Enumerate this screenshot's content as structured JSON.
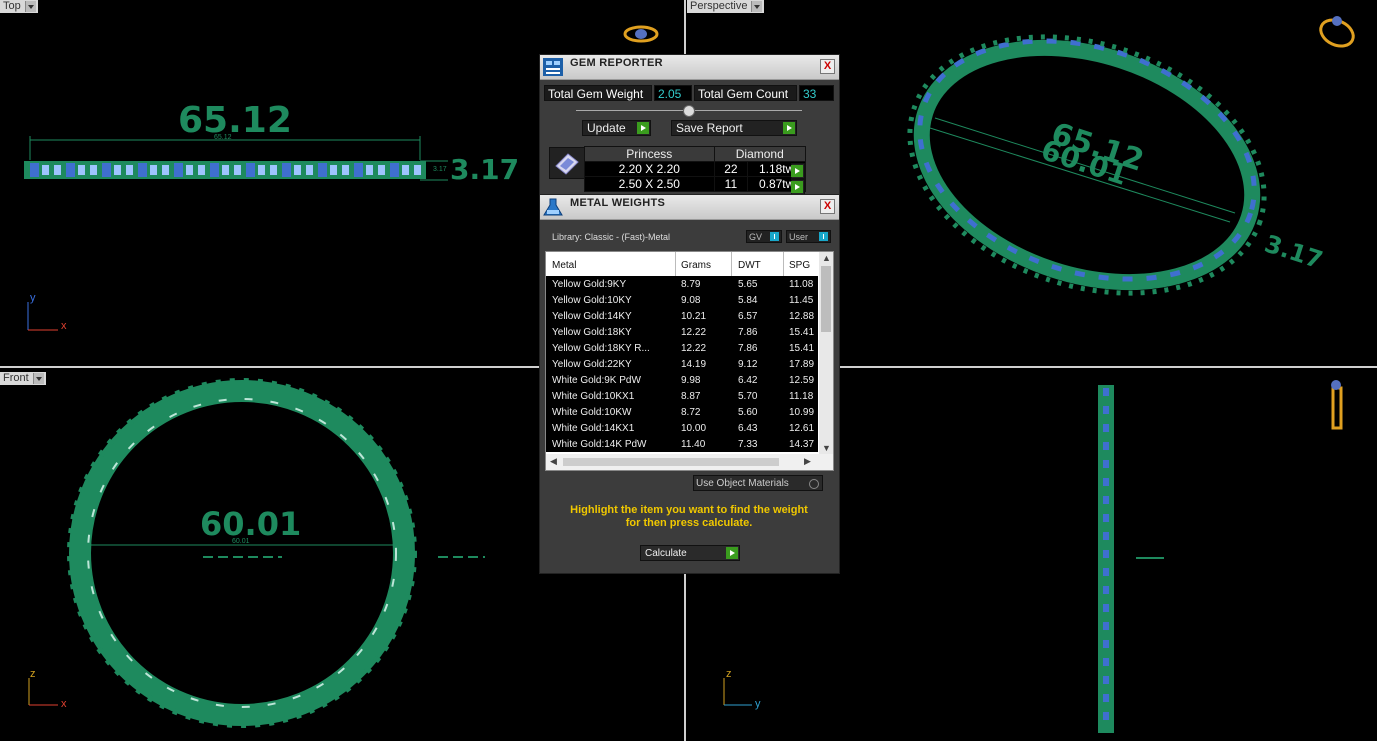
{
  "viewports": {
    "top": {
      "label": "Top",
      "dim_length": "65.12",
      "dim_length_small": "65.12",
      "dim_height": "3.17",
      "dim_height_small": "3.17",
      "axis_y": "y",
      "axis_x": "x"
    },
    "perspective": {
      "label": "Perspective",
      "dim_a": "65.12",
      "dim_b": "60.01",
      "dim_c": "3.17"
    },
    "front": {
      "label": "Front",
      "dim_diameter": "60.01",
      "dim_diameter_small": "60.01",
      "axis_z": "z",
      "axis_x": "x"
    },
    "right": {
      "axis_z": "z",
      "axis_y": "y"
    }
  },
  "gem_reporter": {
    "title": "GEM REPORTER",
    "close_label": "X",
    "total_weight_label": "Total Gem Weight",
    "total_weight_value": "2.05",
    "total_count_label": "Total Gem Count",
    "total_count_value": "33",
    "update_label": "Update",
    "save_report_label": "Save Report",
    "table": {
      "headers": [
        "Princess",
        "Diamond"
      ],
      "rows": [
        {
          "size": "2.20 X 2.20",
          "count": "22",
          "weight": "1.18tw"
        },
        {
          "size": "2.50 X 2.50",
          "count": "11",
          "weight": "0.87tw"
        }
      ]
    }
  },
  "metal_weights": {
    "title": "METAL WEIGHTS",
    "close_label": "X",
    "library_label": "Library: Classic - (Fast)-Metal",
    "gv_label": "GV",
    "user_label": "User",
    "columns": [
      "Metal",
      "Grams",
      "DWT",
      "SPG"
    ],
    "rows": [
      {
        "metal": "Yellow Gold:9KY",
        "grams": "8.79",
        "dwt": "5.65",
        "spg": "11.08"
      },
      {
        "metal": "Yellow Gold:10KY",
        "grams": "9.08",
        "dwt": "5.84",
        "spg": "11.45"
      },
      {
        "metal": "Yellow Gold:14KY",
        "grams": "10.21",
        "dwt": "6.57",
        "spg": "12.88"
      },
      {
        "metal": "Yellow Gold:18KY",
        "grams": "12.22",
        "dwt": "7.86",
        "spg": "15.41"
      },
      {
        "metal": "Yellow Gold:18KY R...",
        "grams": "12.22",
        "dwt": "7.86",
        "spg": "15.41"
      },
      {
        "metal": "Yellow Gold:22KY",
        "grams": "14.19",
        "dwt": "9.12",
        "spg": "17.89"
      },
      {
        "metal": "White Gold:9K PdW",
        "grams": "9.98",
        "dwt": "6.42",
        "spg": "12.59"
      },
      {
        "metal": "White Gold:10KX1",
        "grams": "8.87",
        "dwt": "5.70",
        "spg": "11.18"
      },
      {
        "metal": "White Gold:10KW",
        "grams": "8.72",
        "dwt": "5.60",
        "spg": "10.99"
      },
      {
        "metal": "White Gold:14KX1",
        "grams": "10.00",
        "dwt": "6.43",
        "spg": "12.61"
      },
      {
        "metal": "White Gold:14K PdW",
        "grams": "11.40",
        "dwt": "7.33",
        "spg": "14.37"
      }
    ],
    "use_object_materials_label": "Use Object Materials",
    "hint_line1": "Highlight the item you want to find the weight",
    "hint_line2": "for then press calculate.",
    "calculate_label": "Calculate"
  },
  "colors": {
    "ring_green": "#1e8a5e",
    "stone_blue": "#3f6fd0",
    "accent_yellow": "#f0c800"
  }
}
